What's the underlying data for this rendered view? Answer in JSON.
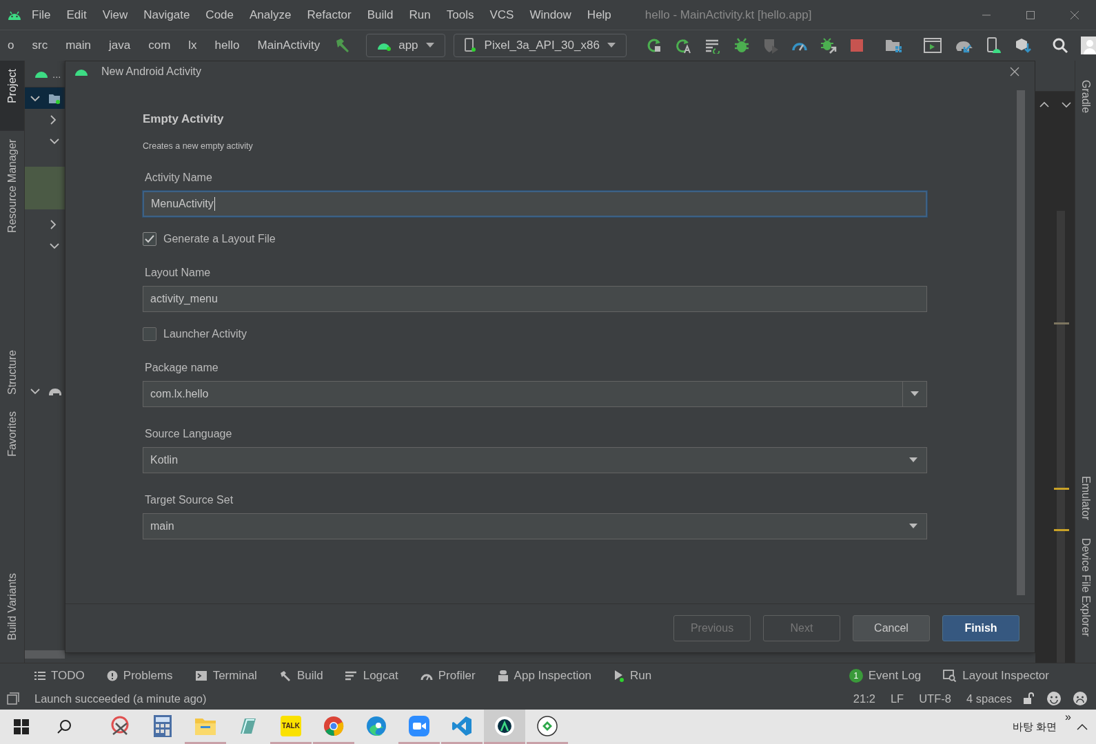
{
  "window": {
    "title": "hello - MainActivity.kt [hello.app]"
  },
  "menu": [
    "File",
    "Edit",
    "View",
    "Navigate",
    "Code",
    "Analyze",
    "Refactor",
    "Build",
    "Run",
    "Tools",
    "VCS",
    "Window",
    "Help"
  ],
  "breadcrumb": [
    "o",
    "src",
    "main",
    "java",
    "com",
    "lx",
    "hello",
    "MainActivity"
  ],
  "run_config": "app",
  "device": "Pixel_3a_API_30_x86",
  "left_tabs": [
    {
      "label": "Project",
      "selected": true
    },
    {
      "label": "Resource Manager",
      "selected": false
    },
    {
      "label": "Structure",
      "selected": false
    },
    {
      "label": "Favorites",
      "selected": false
    },
    {
      "label": "Build Variants",
      "selected": false
    }
  ],
  "right_tabs": [
    "Gradle",
    "Emulator",
    "Device File Explorer"
  ],
  "project": {
    "header": "...",
    "rows": [
      {
        "kind": "folder",
        "expanded": true,
        "selected": true
      },
      {
        "kind": "plain",
        "expanded": false,
        "selected": false
      },
      {
        "kind": "plain",
        "expanded": true,
        "selected": false
      },
      {
        "kind": "plain",
        "expanded": false,
        "selected": false
      },
      {
        "kind": "plain",
        "expanded": true,
        "selected": false
      },
      {
        "kind": "gradle",
        "expanded": true,
        "selected": false
      }
    ]
  },
  "dialog": {
    "title": "New Android Activity",
    "heading": "Empty Activity",
    "description": "Creates a new empty activity",
    "fields": [
      {
        "kind": "text",
        "label": "Activity Name",
        "value": "MenuActivity",
        "focused": true
      },
      {
        "kind": "checkbox",
        "label": "Generate a Layout File",
        "checked": true
      },
      {
        "kind": "text",
        "label": "Layout Name",
        "value": "activity_menu",
        "focused": false
      },
      {
        "kind": "checkbox",
        "label": "Launcher Activity",
        "checked": false
      },
      {
        "kind": "combo",
        "label": "Package name",
        "value": "com.lx.hello"
      },
      {
        "kind": "dropdown",
        "label": "Source Language",
        "value": "Kotlin"
      },
      {
        "kind": "dropdown",
        "label": "Target Source Set",
        "value": "main"
      }
    ],
    "buttons": [
      {
        "label": "Previous",
        "disabled": true,
        "primary": false
      },
      {
        "label": "Next",
        "disabled": true,
        "primary": false
      },
      {
        "label": "Cancel",
        "disabled": false,
        "primary": false
      },
      {
        "label": "Finish",
        "disabled": false,
        "primary": true
      }
    ]
  },
  "tool_windows": [
    {
      "kind": "todo",
      "label": "TODO"
    },
    {
      "kind": "problems",
      "label": "Problems"
    },
    {
      "kind": "terminal",
      "label": "Terminal"
    },
    {
      "kind": "build",
      "label": "Build"
    },
    {
      "kind": "logcat",
      "label": "Logcat"
    },
    {
      "kind": "profiler",
      "label": "Profiler"
    },
    {
      "kind": "inspection",
      "label": "App Inspection"
    },
    {
      "kind": "run",
      "label": "Run"
    }
  ],
  "tool_windows_right": [
    {
      "kind": "eventlog",
      "label": "Event Log",
      "badge": "1"
    },
    {
      "kind": "layout",
      "label": "Layout Inspector"
    }
  ],
  "status": {
    "message": "Launch succeeded (a minute ago)",
    "items": [
      "21:2",
      "LF",
      "UTF-8",
      "4 spaces"
    ]
  },
  "taskbar": {
    "apps": [
      {
        "kind": "snip",
        "running": false,
        "active": false
      },
      {
        "kind": "calc",
        "running": false,
        "active": false
      },
      {
        "kind": "files",
        "running": true,
        "active": false
      },
      {
        "kind": "book",
        "running": false,
        "active": false
      },
      {
        "kind": "talk",
        "label": "TALK",
        "running": true,
        "active": false
      },
      {
        "kind": "chrome",
        "running": true,
        "active": false
      },
      {
        "kind": "edge",
        "running": false,
        "active": false
      },
      {
        "kind": "zoom",
        "running": true,
        "active": false
      },
      {
        "kind": "vscode",
        "running": true,
        "active": false
      },
      {
        "kind": "studio",
        "running": true,
        "active": true
      },
      {
        "kind": "tool",
        "running": true,
        "active": false
      }
    ],
    "desktop_label": "바탕 화면",
    "overflow": "»"
  }
}
